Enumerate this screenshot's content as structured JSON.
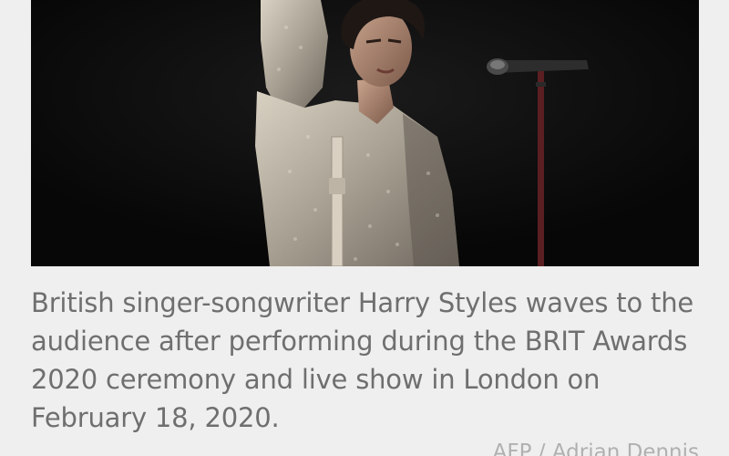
{
  "article": {
    "photo": {
      "description_icon": "news-photo"
    },
    "caption": "British singer-songwriter Harry Styles waves to the audience after performing during the BRIT Awards 2020 ceremony and live show in London on February 18, 2020.",
    "credit": "AFP / Adrian Dennis"
  }
}
